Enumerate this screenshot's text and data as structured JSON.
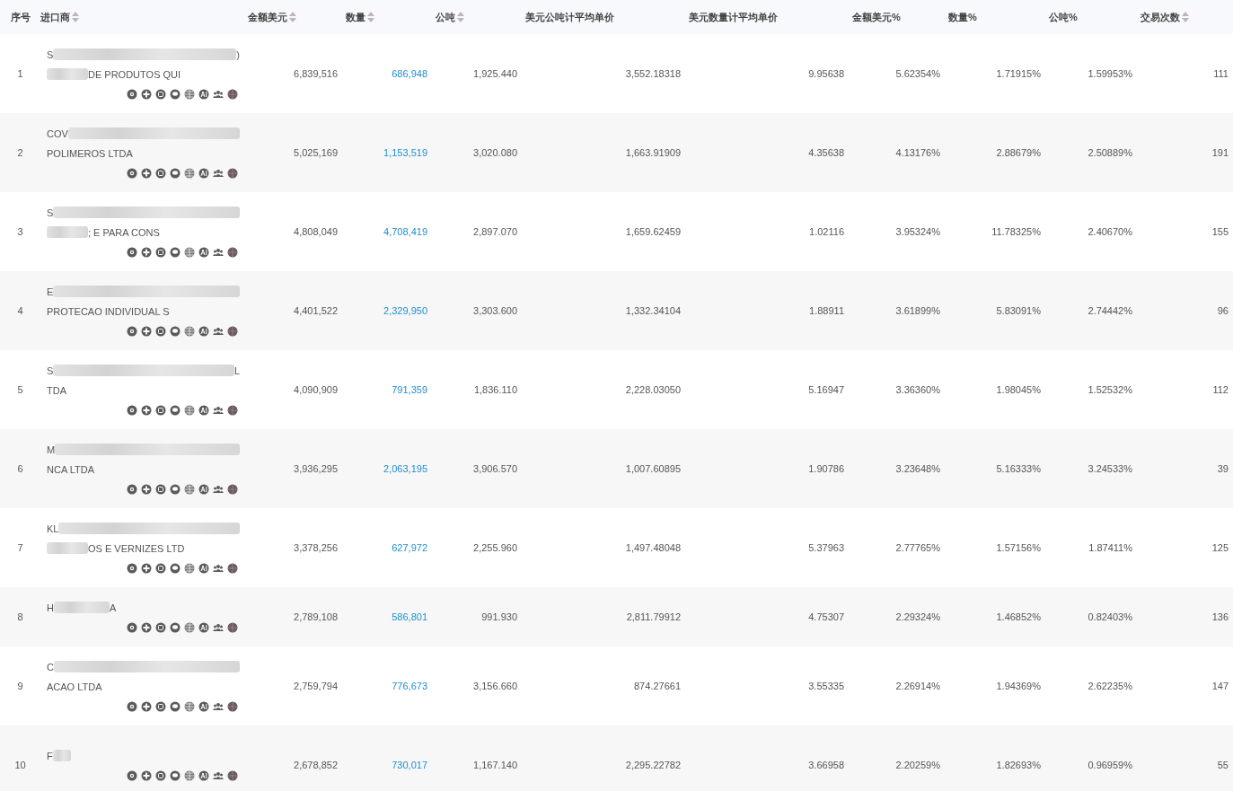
{
  "table": {
    "columns": [
      {
        "label": "序号",
        "sortable": false
      },
      {
        "label": "进口商",
        "sortable": true
      },
      {
        "label": "金额美元",
        "sortable": true
      },
      {
        "label": "数量",
        "sortable": true
      },
      {
        "label": "公吨",
        "sortable": true
      },
      {
        "label": "美元公吨计平均单价",
        "sortable": false
      },
      {
        "label": "美元数量计平均单价",
        "sortable": false
      },
      {
        "label": "金额美元%",
        "sortable": false
      },
      {
        "label": "数量%",
        "sortable": false
      },
      {
        "label": "公吨%",
        "sortable": false
      },
      {
        "label": "交易次数",
        "sortable": true
      }
    ],
    "rows": [
      {
        "index": "1",
        "importer": [
          [
            {
              "kind": "text",
              "text": "S"
            },
            {
              "kind": "blur-long"
            },
            {
              "kind": "text",
              "text": ")"
            }
          ],
          [
            {
              "kind": "blur-short"
            },
            {
              "kind": "text",
              "text": "DE PRODUTOS QUI"
            }
          ]
        ],
        "amount": "6,839,516",
        "quantity": "686,948",
        "tons": "1,925.440",
        "price_ton": "3,552.18318",
        "price_qty": "9.95638",
        "amount_pct": "5.62354%",
        "qty_pct": "1.71915%",
        "tons_pct": "1.59953%",
        "trades": "111"
      },
      {
        "index": "2",
        "importer": [
          [
            {
              "kind": "text",
              "text": "COV"
            },
            {
              "kind": "blur-long"
            }
          ],
          [
            {
              "kind": "text",
              "text": "POLIMEROS LTDA"
            }
          ]
        ],
        "amount": "5,025,169",
        "quantity": "1,153,519",
        "tons": "3,020.080",
        "price_ton": "1,663.91909",
        "price_qty": "4.35638",
        "amount_pct": "4.13176%",
        "qty_pct": "2.88679%",
        "tons_pct": "2.50889%",
        "trades": "191"
      },
      {
        "index": "3",
        "importer": [
          [
            {
              "kind": "text",
              "text": "S"
            },
            {
              "kind": "blur-long"
            }
          ],
          [
            {
              "kind": "blur-short"
            },
            {
              "kind": "text",
              "text": "; E PARA CONS"
            }
          ]
        ],
        "amount": "4,808,049",
        "quantity": "4,708,419",
        "tons": "2,897.070",
        "price_ton": "1,659.62459",
        "price_qty": "1.02116",
        "amount_pct": "3.95324%",
        "qty_pct": "11.78325%",
        "tons_pct": "2.40670%",
        "trades": "155"
      },
      {
        "index": "4",
        "importer": [
          [
            {
              "kind": "text",
              "text": "E"
            },
            {
              "kind": "blur-long"
            }
          ],
          [
            {
              "kind": "text",
              "text": "PROTECAO INDIVIDUAL S"
            }
          ]
        ],
        "amount": "4,401,522",
        "quantity": "2,329,950",
        "tons": "3,303.600",
        "price_ton": "1,332.34104",
        "price_qty": "1.88911",
        "amount_pct": "3.61899%",
        "qty_pct": "5.83091%",
        "tons_pct": "2.74442%",
        "trades": "96"
      },
      {
        "index": "5",
        "importer": [
          [
            {
              "kind": "text",
              "text": "S"
            },
            {
              "kind": "blur-long"
            },
            {
              "kind": "text",
              "text": "L"
            }
          ],
          [
            {
              "kind": "text",
              "text": "TDA"
            }
          ]
        ],
        "amount": "4,090,909",
        "quantity": "791,359",
        "tons": "1,836.110",
        "price_ton": "2,228.03050",
        "price_qty": "5.16947",
        "amount_pct": "3.36360%",
        "qty_pct": "1.98045%",
        "tons_pct": "1.52532%",
        "trades": "112"
      },
      {
        "index": "6",
        "importer": [
          [
            {
              "kind": "text",
              "text": "M"
            },
            {
              "kind": "blur-long"
            }
          ],
          [
            {
              "kind": "text",
              "text": "NCA LTDA"
            }
          ]
        ],
        "amount": "3,936,295",
        "quantity": "2,063,195",
        "tons": "3,906.570",
        "price_ton": "1,007.60895",
        "price_qty": "1.90786",
        "amount_pct": "3.23648%",
        "qty_pct": "5.16333%",
        "tons_pct": "3.24533%",
        "trades": "39"
      },
      {
        "index": "7",
        "importer": [
          [
            {
              "kind": "text",
              "text": "KL"
            },
            {
              "kind": "blur-long"
            }
          ],
          [
            {
              "kind": "blur-short"
            },
            {
              "kind": "text",
              "text": "OS E VERNIZES LTD"
            }
          ]
        ],
        "amount": "3,378,256",
        "quantity": "627,972",
        "tons": "2,255.960",
        "price_ton": "1,497.48048",
        "price_qty": "5.37963",
        "amount_pct": "2.77765%",
        "qty_pct": "1.57156%",
        "tons_pct": "1.87411%",
        "trades": "125"
      },
      {
        "index": "8",
        "importer": [
          [
            {
              "kind": "text",
              "text": "H"
            },
            {
              "kind": "blur-medium"
            },
            {
              "kind": "text",
              "text": "A"
            }
          ]
        ],
        "amount": "2,789,108",
        "quantity": "586,801",
        "tons": "991.930",
        "price_ton": "2,811.79912",
        "price_qty": "4.75307",
        "amount_pct": "2.29324%",
        "qty_pct": "1.46852%",
        "tons_pct": "0.82403%",
        "trades": "136"
      },
      {
        "index": "9",
        "importer": [
          [
            {
              "kind": "text",
              "text": "C"
            },
            {
              "kind": "blur-long"
            }
          ],
          [
            {
              "kind": "text",
              "text": "ACAO LTDA"
            }
          ]
        ],
        "amount": "2,759,794",
        "quantity": "776,673",
        "tons": "3,156.660",
        "price_ton": "874.27661",
        "price_qty": "3.55335",
        "amount_pct": "2.26914%",
        "qty_pct": "1.94369%",
        "tons_pct": "2.62235%",
        "trades": "147"
      },
      {
        "index": "10",
        "importer": [
          [
            {
              "kind": "text",
              "text": "F"
            },
            {
              "kind": "blur-tiny"
            }
          ]
        ],
        "amount": "2,678,852",
        "quantity": "730,017",
        "tons": "1,167.140",
        "price_ton": "2,295.22782",
        "price_qty": "3.66958",
        "amount_pct": "2.20259%",
        "qty_pct": "1.82693%",
        "tons_pct": "0.96959%",
        "trades": "55"
      }
    ]
  }
}
